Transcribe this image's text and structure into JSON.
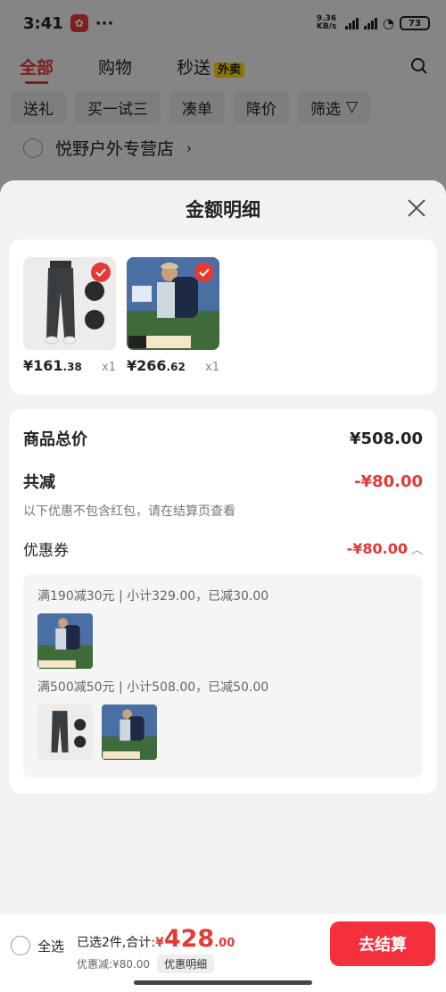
{
  "status": {
    "time": "3:41",
    "net_speed": "9.36 KB/s",
    "battery": "73"
  },
  "top_tabs": {
    "all": "全部",
    "shopping": "购物",
    "instant": "秒送",
    "waimai": "外卖"
  },
  "filters": [
    "送礼",
    "买一试三",
    "凑单",
    "降价",
    "筛选"
  ],
  "store": {
    "name": "悦野户外专营店"
  },
  "sheet": {
    "title": "金额明细"
  },
  "products": [
    {
      "name": "pants",
      "price_int": "161",
      "price_dec": ".38",
      "qty": "x1"
    },
    {
      "name": "backpack",
      "price_int": "266",
      "price_dec": ".62",
      "qty": "x1"
    }
  ],
  "summary": {
    "total_label": "商品总价",
    "total_value": "¥508.00",
    "discount_label": "共减",
    "discount_value": "-¥80.00",
    "discount_note": "以下优惠不包含红包，请在结算页查看",
    "coupon_label": "优惠券",
    "coupon_value": "-¥80.00"
  },
  "coupon_rules": [
    {
      "text": "满190减30元 | 小计329.00，已减30.00"
    },
    {
      "text": "满500减50元 | 小计508.00，已减50.00"
    }
  ],
  "bottom": {
    "select_all": "全选",
    "selected_text": "已选2件,合计:",
    "currency": "¥",
    "total_int": "428",
    "total_dec": ".00",
    "discount_text": "优惠减:¥80.00",
    "detail_button": "优惠明细",
    "checkout_button": "去结算"
  },
  "colors": {
    "accent": "#e53935",
    "checkout": "#f5303d"
  }
}
